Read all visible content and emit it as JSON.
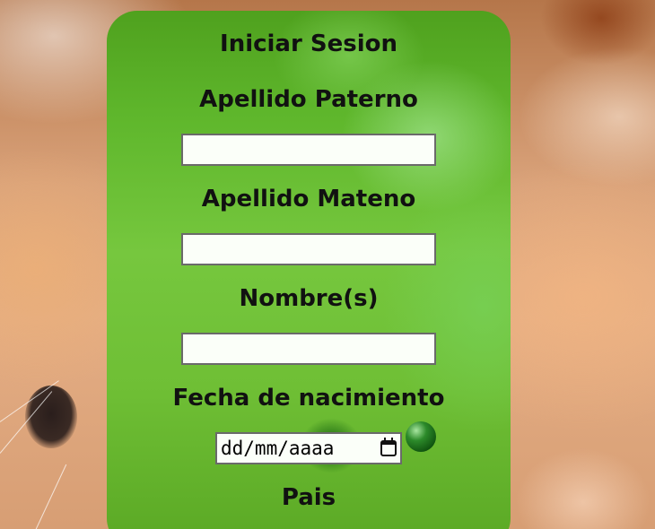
{
  "form": {
    "title": "Iniciar Sesion",
    "fields": {
      "apellido_paterno": {
        "label": "Apellido Paterno",
        "value": ""
      },
      "apellido_materno": {
        "label": "Apellido Mateno",
        "value": ""
      },
      "nombre": {
        "label": "Nombre(s)",
        "value": ""
      },
      "fecha_nacimiento": {
        "label": "Fecha de nacimiento",
        "placeholder": "dd/mm/aaaa"
      },
      "pais": {
        "label": "Pais"
      }
    }
  },
  "colors": {
    "panel_green": "#5fb72c",
    "input_background": "#fbfff9",
    "input_border": "#6a6a6a",
    "text": "#111111"
  },
  "icons": {
    "date_picker": "calendar-icon"
  }
}
